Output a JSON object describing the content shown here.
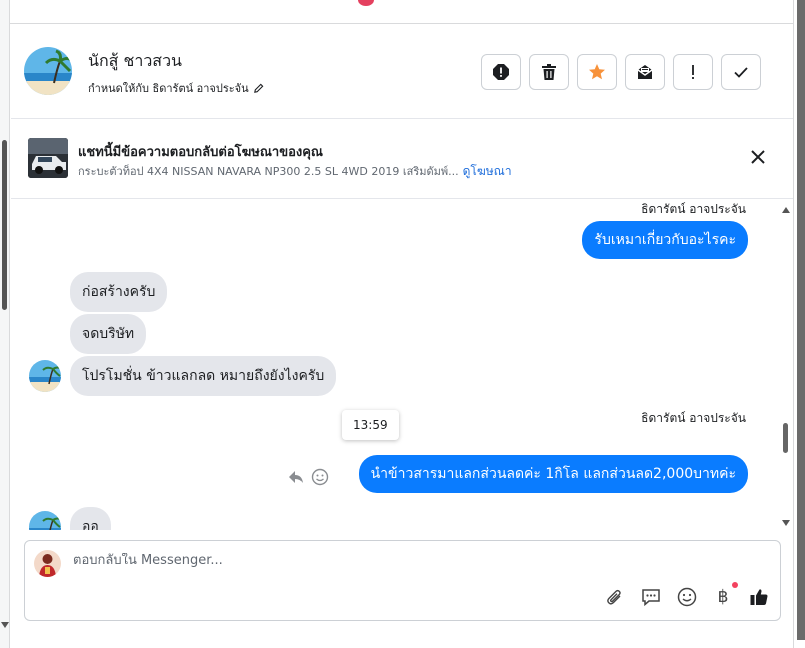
{
  "colors": {
    "accent": "#0a7cff",
    "incoming": "#e4e6eb",
    "star": "#f7923b",
    "link": "#216fdb"
  },
  "header": {
    "name": "นักสู้ ชาวสวน",
    "assign_label": "กำหนดให้กับ ธิดารัตน์ อาจประจัน",
    "actions": [
      "spam-icon",
      "trash-icon",
      "star-icon",
      "mark-unread-icon",
      "important-icon",
      "done-icon"
    ]
  },
  "banner": {
    "title": "แชทนี้มีข้อความตอบกลับต่อโฆษณาของคุณ",
    "subtitle": "กระบะตัวท็อป 4X4 NISSAN NAVARA NP300 2.5 SL 4WD 2019 เสริมดัมพ์...",
    "link": "ดูโฆษณา"
  },
  "messages": {
    "sender_1": "ธิดารัตน์ อาจประจัน",
    "out_1": "รับเหมาเกี่ยวกับอะไรคะ",
    "in_1": "ก่อสร้างครับ",
    "in_2": "จดบริษัท",
    "in_3": "โปรโมชั่น  ข้าวแลกลด หมายถึงยังไงครับ",
    "tooltip_time": "13:59",
    "sender_2": "ธิดารัตน์ อาจประจัน",
    "out_2": "นำข้าวสารมาแลกส่วนลดค่ะ 1กิโล แลกส่วนลด2,000บาทค่ะ",
    "in_4": "ออ"
  },
  "composer": {
    "placeholder": "ตอบกลับใน Messenger...",
    "tools": [
      "attach-icon",
      "saved-replies-icon",
      "emoji-icon",
      "payment-icon",
      "like-icon"
    ]
  }
}
